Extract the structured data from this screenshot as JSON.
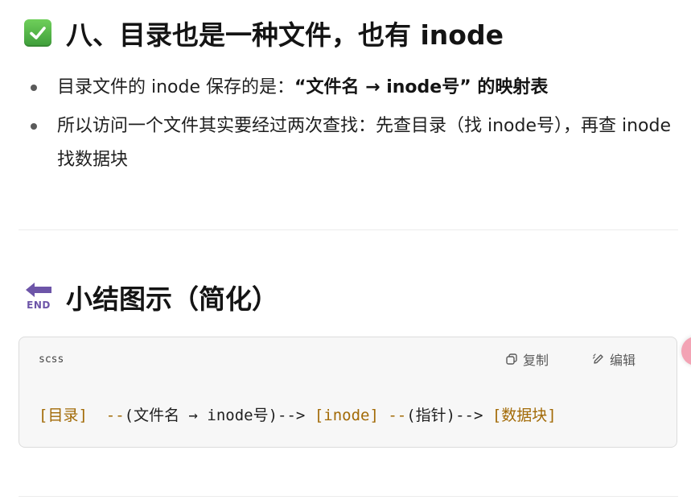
{
  "section1": {
    "icon": "check-mark-button-icon",
    "title": "八、目录也是一种文件，也有 inode",
    "bullets": [
      {
        "plain": "目录文件的 inode 保存的是：",
        "bold": "“文件名 → inode号” 的映射表"
      },
      {
        "plain": "所以访问一个文件其实要经过两次查找：先查目录（找 inode号），再查 inode 找数据块",
        "bold": ""
      }
    ]
  },
  "section2": {
    "icon": "end-arrow-icon",
    "icon_text": "END",
    "title": "小结图示（简化）"
  },
  "code_block": {
    "language": "scss",
    "copy_label": "复制",
    "edit_label": "编辑",
    "tokens": {
      "t1": "[目录]",
      "t2": "  --",
      "t3": "(文件名 → inode号)-->",
      "t4": " [inode]",
      "t5": " --",
      "t6": "(指针)-->",
      "t7": " [数据块]"
    }
  },
  "colors": {
    "code_selector": "#a26a06",
    "check_green": "#3e9d3a",
    "end_purple": "#6d55a8",
    "side_button_pink": "#f3a3b4"
  }
}
